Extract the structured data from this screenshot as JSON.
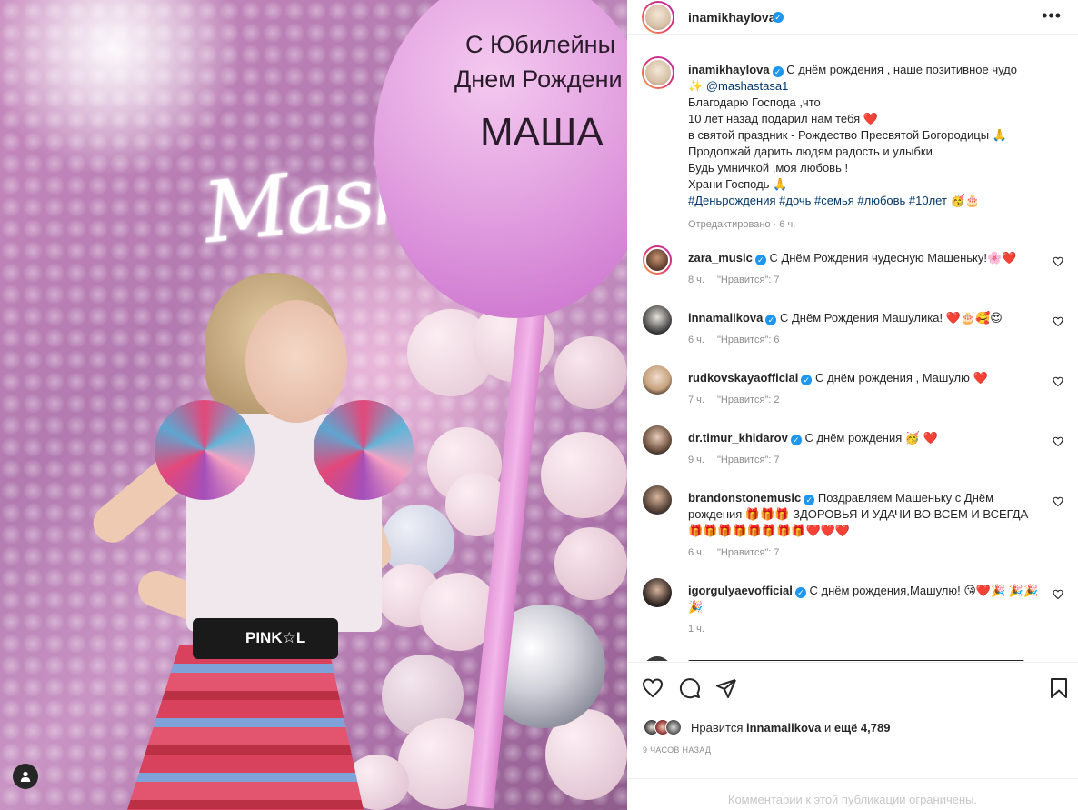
{
  "photo": {
    "balloon_text": [
      "С Юбилейны",
      "Днем Рождени",
      "МАША"
    ],
    "neon_sign": "Masha",
    "belt_text": "PINK☆L"
  },
  "post": {
    "author": "inamikhaylova",
    "caption": {
      "author": "inamikhaylova",
      "lines": [
        "С днём рождения , наше позитивное чудо",
        "@mashastasa1",
        "Благодарю Господа ,что",
        "10 лет назад подарил нам тебя ❤️",
        "в святой праздник - Рождество Пресвятой Богородицы 🙏",
        "Продолжай дарить людям радость и улыбки",
        "Будь умничкой ,моя любовь !",
        "Храни Господь 🙏"
      ],
      "first_line_emoji": "✨",
      "hashtags": "#Деньрождения #дочь #семья #любовь #10лет 🥳🎂",
      "edited": "Отредактировано",
      "edited_time": "6 ч."
    }
  },
  "comments": [
    {
      "user": "zara_music",
      "verified": true,
      "text": "С Днём Рождения чудесную Машеньку!🌸❤️",
      "time": "8 ч.",
      "likes": "\"Нравится\": 7"
    },
    {
      "user": "innamalikova",
      "verified": true,
      "text": "С Днём Рождения Машулика! ❤️🎂🥰😍",
      "time": "6 ч.",
      "likes": "\"Нравится\": 6"
    },
    {
      "user": "rudkovskayaofficial",
      "verified": true,
      "text": "С днём рождения , Машулю ❤️",
      "time": "7 ч.",
      "likes": "\"Нравится\": 2"
    },
    {
      "user": "dr.timur_khidarov",
      "verified": true,
      "text": "С днём рождения 🥳 ❤️",
      "time": "9 ч.",
      "likes": "\"Нравится\": 7"
    },
    {
      "user": "brandonstonemusic",
      "verified": true,
      "text": "Поздравляем Машеньку с Днём рождения 🎁🎁🎁 ЗДОРОВЬЯ И УДАЧИ ВО ВСЕМ И ВСЕГДА 🎁🎁🎁🎁🎁🎁🎁🎁❤️❤️❤️",
      "time": "6 ч.",
      "likes": "\"Нравится\": 7"
    },
    {
      "user": "igorgulyaevofficial",
      "verified": true,
      "text": "С днём рождения,Машулю! 😘❤️🎉 🎉🎉🎉",
      "time": "1 ч.",
      "likes": ""
    }
  ],
  "footer": {
    "liked_prefix": "Нравится",
    "liked_user": "innamalikova",
    "liked_middle": "и",
    "liked_count": "ещё 4,789",
    "posted_ago": "9 часов назад",
    "comments_limited": "Комментарии к этой публикации ограничены."
  },
  "colors": {
    "accent_blue": "#0095f6",
    "verified_blue": "#1c96ef",
    "link": "#00376b",
    "muted": "#8e8e8e"
  }
}
